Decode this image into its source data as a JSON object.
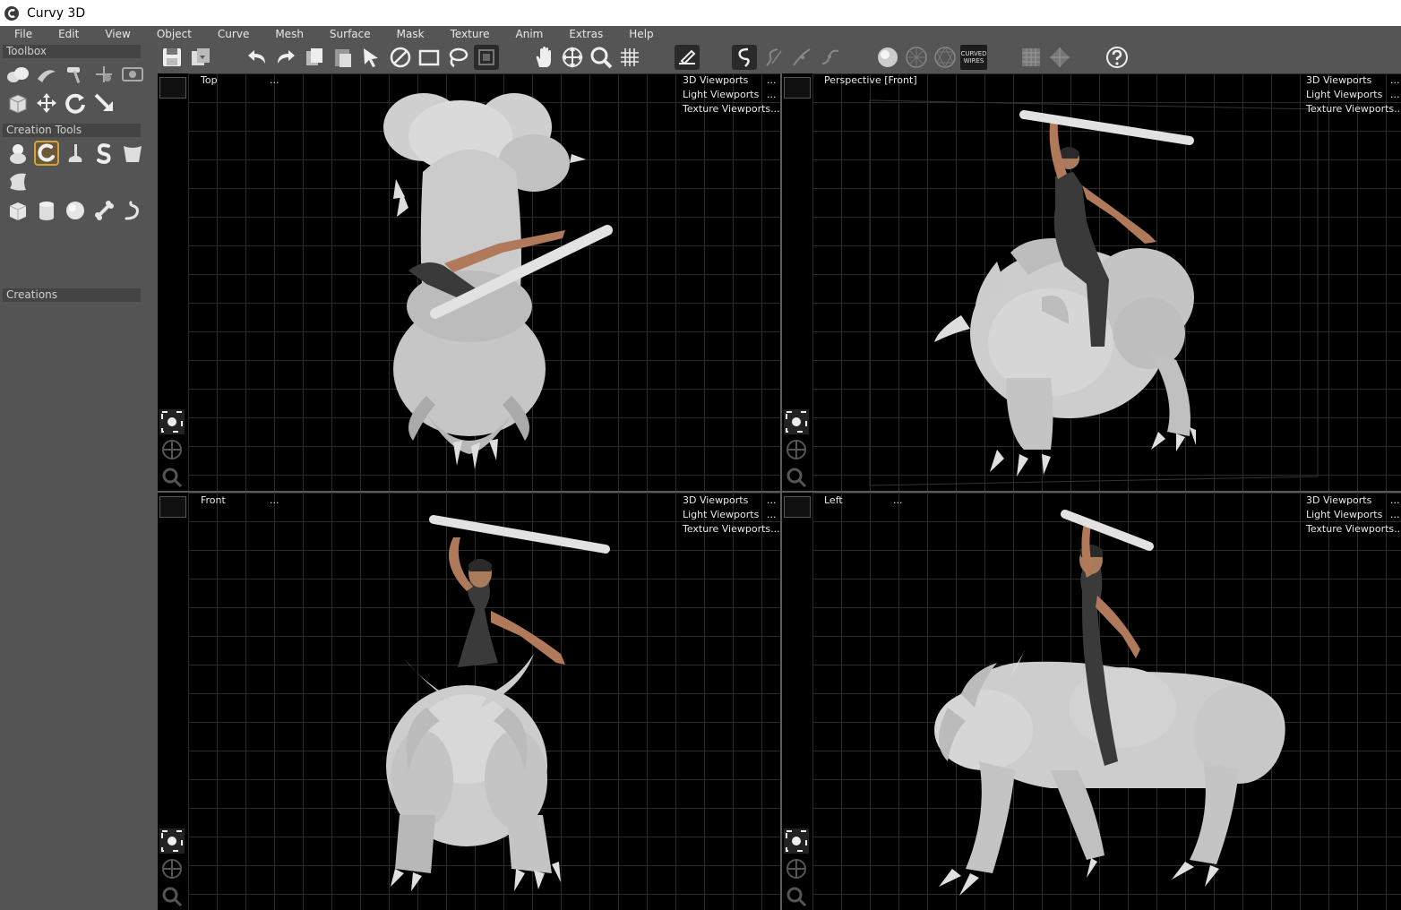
{
  "window": {
    "title": "Curvy 3D"
  },
  "menu": [
    "File",
    "Edit",
    "View",
    "Object",
    "Curve",
    "Mesh",
    "Surface",
    "Mask",
    "Texture",
    "Anim",
    "Extras",
    "Help"
  ],
  "left_panel": {
    "toolbox": "Toolbox",
    "creation_tools": "Creation Tools",
    "creations": "Creations"
  },
  "toolbar": {
    "curved_wires_line1": "CURVED",
    "curved_wires_line2": "WIRES"
  },
  "viewport_links": {
    "viewports3d": "3D Viewports",
    "light": "Light Viewports",
    "texture": "Texture Viewports...",
    "dots": "..."
  },
  "viewports": [
    {
      "name": "Top"
    },
    {
      "name": "Perspective [Front]"
    },
    {
      "name": "Front"
    },
    {
      "name": "Left"
    }
  ],
  "colors": {
    "accent": "#d4a23a",
    "model": "#c8c8c8",
    "grid": "#2b2b2b",
    "panel": "#545454"
  }
}
